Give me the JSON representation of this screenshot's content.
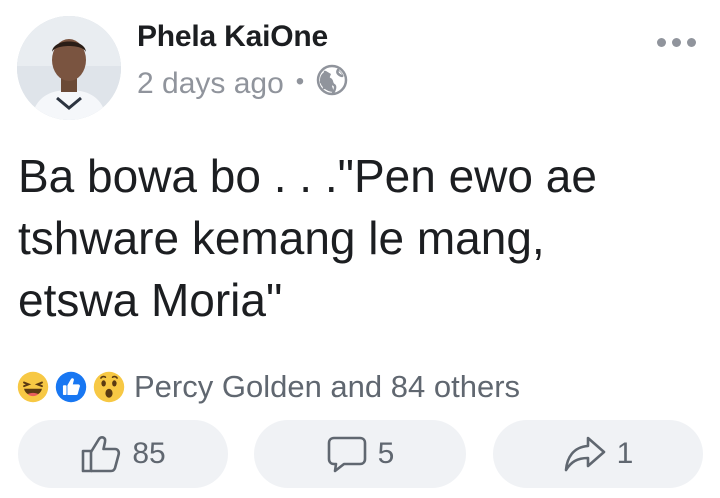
{
  "post": {
    "author": "Phela KaiOne",
    "time": "2 days ago",
    "separator": "•",
    "privacy_icon": "globe-icon",
    "text": "Ba bowa bo . . .\"Pen ewo ae\ntshware kemang le mang,\netswa Moria\""
  },
  "reactions": {
    "types": [
      "haha",
      "like",
      "wow"
    ],
    "summary": "Percy Golden and 84 others"
  },
  "actions": {
    "like_count": "85",
    "comment_count": "5",
    "share_count": "1"
  },
  "colors": {
    "like_blue": "#1877f2",
    "emoji_yellow": "#f7c844",
    "muted_gray": "#90949c",
    "button_bg": "#f0f2f5"
  }
}
